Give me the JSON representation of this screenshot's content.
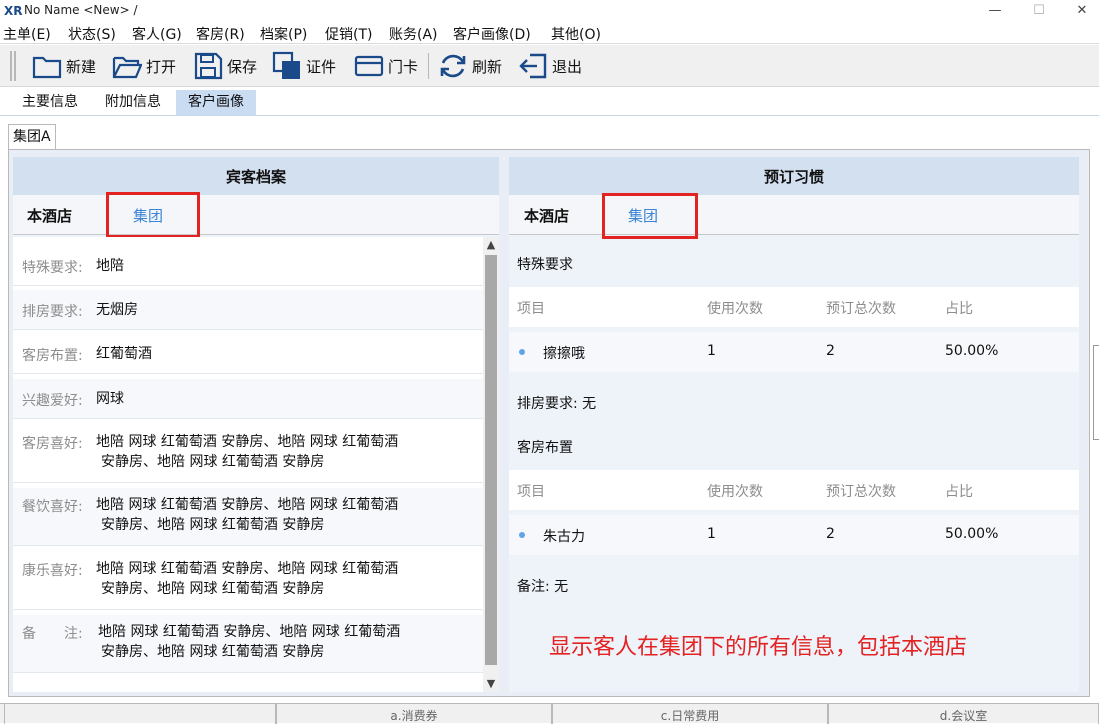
{
  "window": {
    "title": "No Name <New> /",
    "logo": "XR",
    "minimize": "—",
    "maximize": "☐",
    "close": "✕"
  },
  "menu": [
    "主单(E)",
    "状态(S)",
    "客人(G)",
    "客房(R)",
    "档案(P)",
    "促销(T)",
    "账务(A)",
    "客户画像(D)",
    "其他(O)"
  ],
  "toolbar": {
    "new_label": "新建",
    "open_label": "打开",
    "save_label": "保存",
    "id_label": "证件",
    "card_label": "门卡",
    "refresh_label": "刷新",
    "exit_label": "退出"
  },
  "tabs": {
    "main_info": "主要信息",
    "extra_info": "附加信息",
    "portrait": "客户画像"
  },
  "subtab": "集团A",
  "left_panel": {
    "title": "宾客档案",
    "this_hotel": "本酒店",
    "group": "集团",
    "rows": [
      {
        "label": "特殊要求:",
        "line1": "地陪",
        "line2": ""
      },
      {
        "label": "排房要求:",
        "line1": "无烟房",
        "line2": ""
      },
      {
        "label": "客房布置:",
        "line1": "红葡萄酒",
        "line2": ""
      },
      {
        "label": "兴趣爱好:",
        "line1": "网球",
        "line2": ""
      },
      {
        "label": "客房喜好:",
        "line1": "地陪 网球 红葡萄酒 安静房、地陪 网球 红葡萄酒",
        "line2": "安静房、地陪 网球 红葡萄酒 安静房"
      },
      {
        "label": "餐饮喜好:",
        "line1": "地陪 网球 红葡萄酒 安静房、地陪 网球 红葡萄酒",
        "line2": "安静房、地陪 网球 红葡萄酒 安静房"
      },
      {
        "label": "康乐喜好:",
        "line1": "地陪 网球 红葡萄酒 安静房、地陪 网球 红葡萄酒",
        "line2": "安静房、地陪 网球 红葡萄酒 安静房"
      },
      {
        "label": "备　　注:",
        "line1": "地陪 网球 红葡萄酒 安静房、地陪 网球 红葡萄酒",
        "line2": "安静房、地陪 网球 红葡萄酒 安静房"
      }
    ]
  },
  "right_panel": {
    "title": "预订习惯",
    "this_hotel": "本酒店",
    "group": "集团",
    "special": {
      "heading": "特殊要求",
      "columns": [
        "项目",
        "使用次数",
        "预订总次数",
        "占比"
      ],
      "row": {
        "item": "擦擦哦",
        "uses": "1",
        "total": "2",
        "ratio": "50.00%"
      }
    },
    "room_req": "排房要求: 无",
    "room_setup": {
      "heading": "客房布置",
      "columns": [
        "项目",
        "使用次数",
        "预订总次数",
        "占比"
      ],
      "row": {
        "item": "朱古力",
        "uses": "1",
        "total": "2",
        "ratio": "50.00%"
      }
    },
    "note": "备注: 无",
    "annotation": "显示客人在集团下的所有信息，包括本酒店"
  },
  "bottom_tabs": [
    "a.消费券",
    "c.日常费用",
    "d.会议室"
  ],
  "colors": {
    "accent_blue": "#3b84d8",
    "highlight_red": "#e32222",
    "header_bg": "#d3e0f0"
  }
}
